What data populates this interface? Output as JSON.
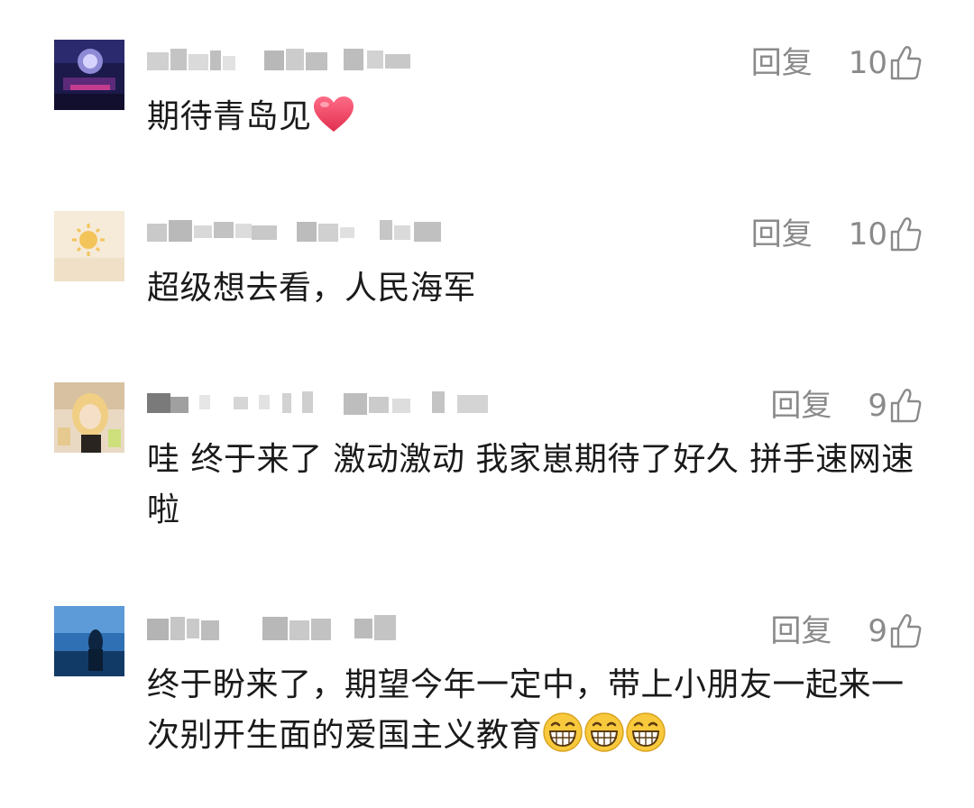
{
  "comments": [
    {
      "username": "Ls.小 私 网名 用户",
      "reply_label": "回复",
      "likes": "10",
      "text": "期待青岛见",
      "emoji_trailing": [
        "heart-emoji"
      ]
    },
    {
      "username": "用户 昵称 名 字",
      "reply_label": "回复",
      "likes": "10",
      "text": "超级想去看，人民海军",
      "emoji_trailing": []
    },
    {
      "username": "昵称 隐藏 用户名",
      "reply_label": "回复",
      "likes": "9",
      "text": "哇 终于来了 激动激动 我家崽期待了好久 拼手速网速啦",
      "emoji_trailing": []
    },
    {
      "username": "网友 昵称 用户",
      "reply_label": "回复",
      "likes": "9",
      "text": "终于盼来了，期望今年一定中，带上小朋友一起来一次别开生面的爱国主义教育",
      "emoji_trailing": [
        "grin-emoji",
        "grin-emoji",
        "grin-emoji"
      ]
    }
  ],
  "colors": {
    "secondary_text": "#8a8a8a",
    "primary_text": "#1a1a1a"
  },
  "icons": {
    "like": "thumb-up-icon",
    "heart": "heart-emoji",
    "grin": "grin-emoji"
  }
}
